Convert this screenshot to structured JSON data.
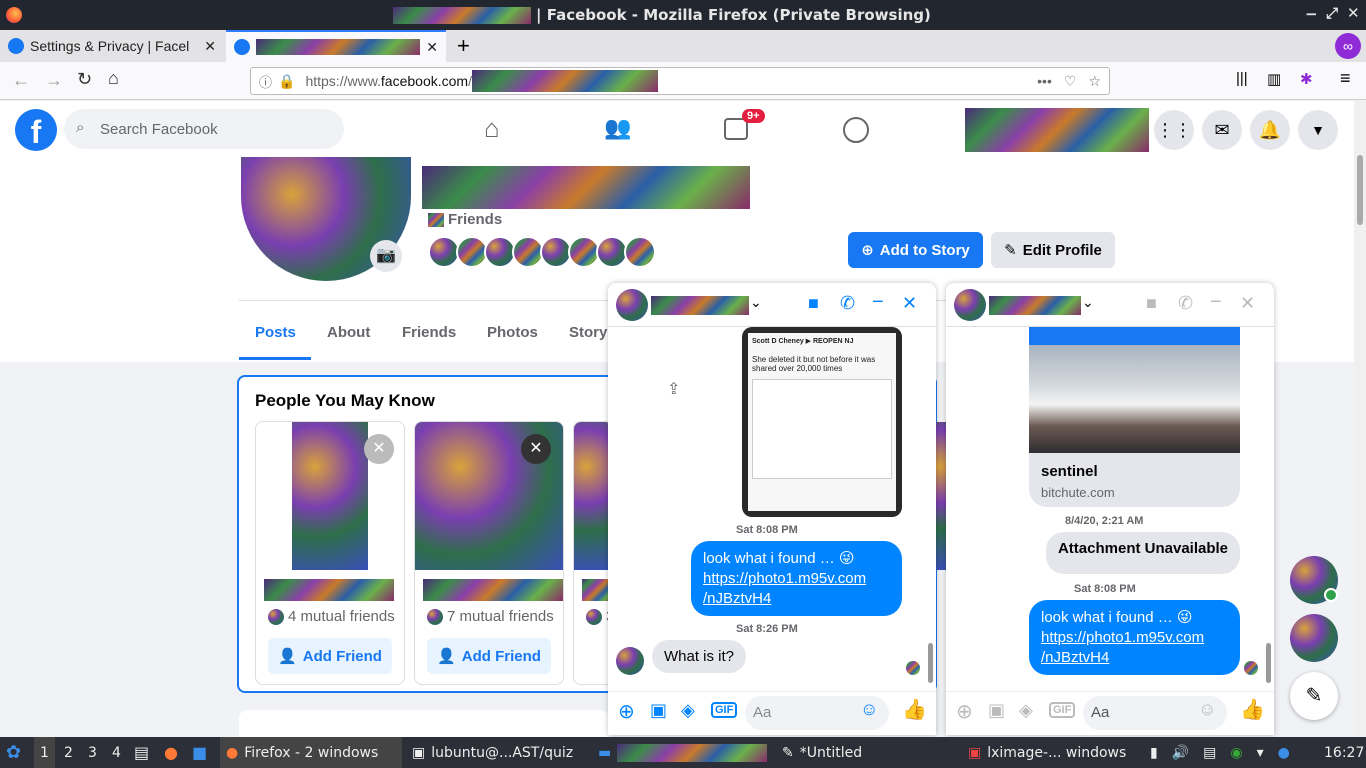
{
  "window": {
    "title": "| Facebook - Mozilla Firefox (Private Browsing)"
  },
  "tabs": [
    {
      "label": "Settings & Privacy | Facel"
    },
    {
      "label": ""
    }
  ],
  "url": {
    "prefix": "https://www.",
    "domain": "facebook.com",
    "path": "/"
  },
  "fb": {
    "search_placeholder": "Search Facebook",
    "watch_badge": "9+"
  },
  "profile": {
    "friends_label": "Friends",
    "add_story": "Add to Story",
    "edit_profile": "Edit Profile",
    "tabs": [
      "Posts",
      "About",
      "Friends",
      "Photos",
      "Story"
    ]
  },
  "pymk": {
    "title": "People You May Know",
    "cards": [
      {
        "mutual": "4 mutual friends",
        "action": "Add Friend"
      },
      {
        "mutual": "7 mutual friends",
        "action": "Add Friend"
      },
      {
        "mutual": "3",
        "action": ""
      }
    ]
  },
  "chat1": {
    "post_author": "Scott D Cheney ▶ REOPEN NJ",
    "post_text": "She deleted it but not before it was shared over 20,000 times",
    "stamp1": "Sat 8:08 PM",
    "msg1_text": "look what i found … 😜",
    "msg1_link1": "https://photo1.m95v.com",
    "msg1_link2": "/nJBztvH4",
    "stamp2": "Sat 8:26 PM",
    "reply": "What is it?",
    "input_placeholder": "Aa"
  },
  "chat2": {
    "link_title": "sentinel",
    "link_domain": "bitchute.com",
    "stamp0": "8/4/20, 2:21 AM",
    "unavailable": "Attachment Unavailable",
    "stamp1": "Sat 8:08 PM",
    "msg1_text": "look what i found … 😜",
    "msg1_link1": "https://photo1.m95v.com",
    "msg1_link2": "/nJBztvH4",
    "input_placeholder": "Aa"
  },
  "taskbar": {
    "workspaces": [
      "1",
      "2",
      "3",
      "4"
    ],
    "firefox": "Firefox - 2 windows",
    "terminal": "lubuntu@...AST/quiz",
    "untitled": "*Untitled",
    "lximage": "lximage-... windows",
    "clock": "16:27"
  },
  "colors": {
    "fb_blue": "#1877f2",
    "messenger_blue": "#0084ff",
    "badge_red": "#e41e3f"
  }
}
